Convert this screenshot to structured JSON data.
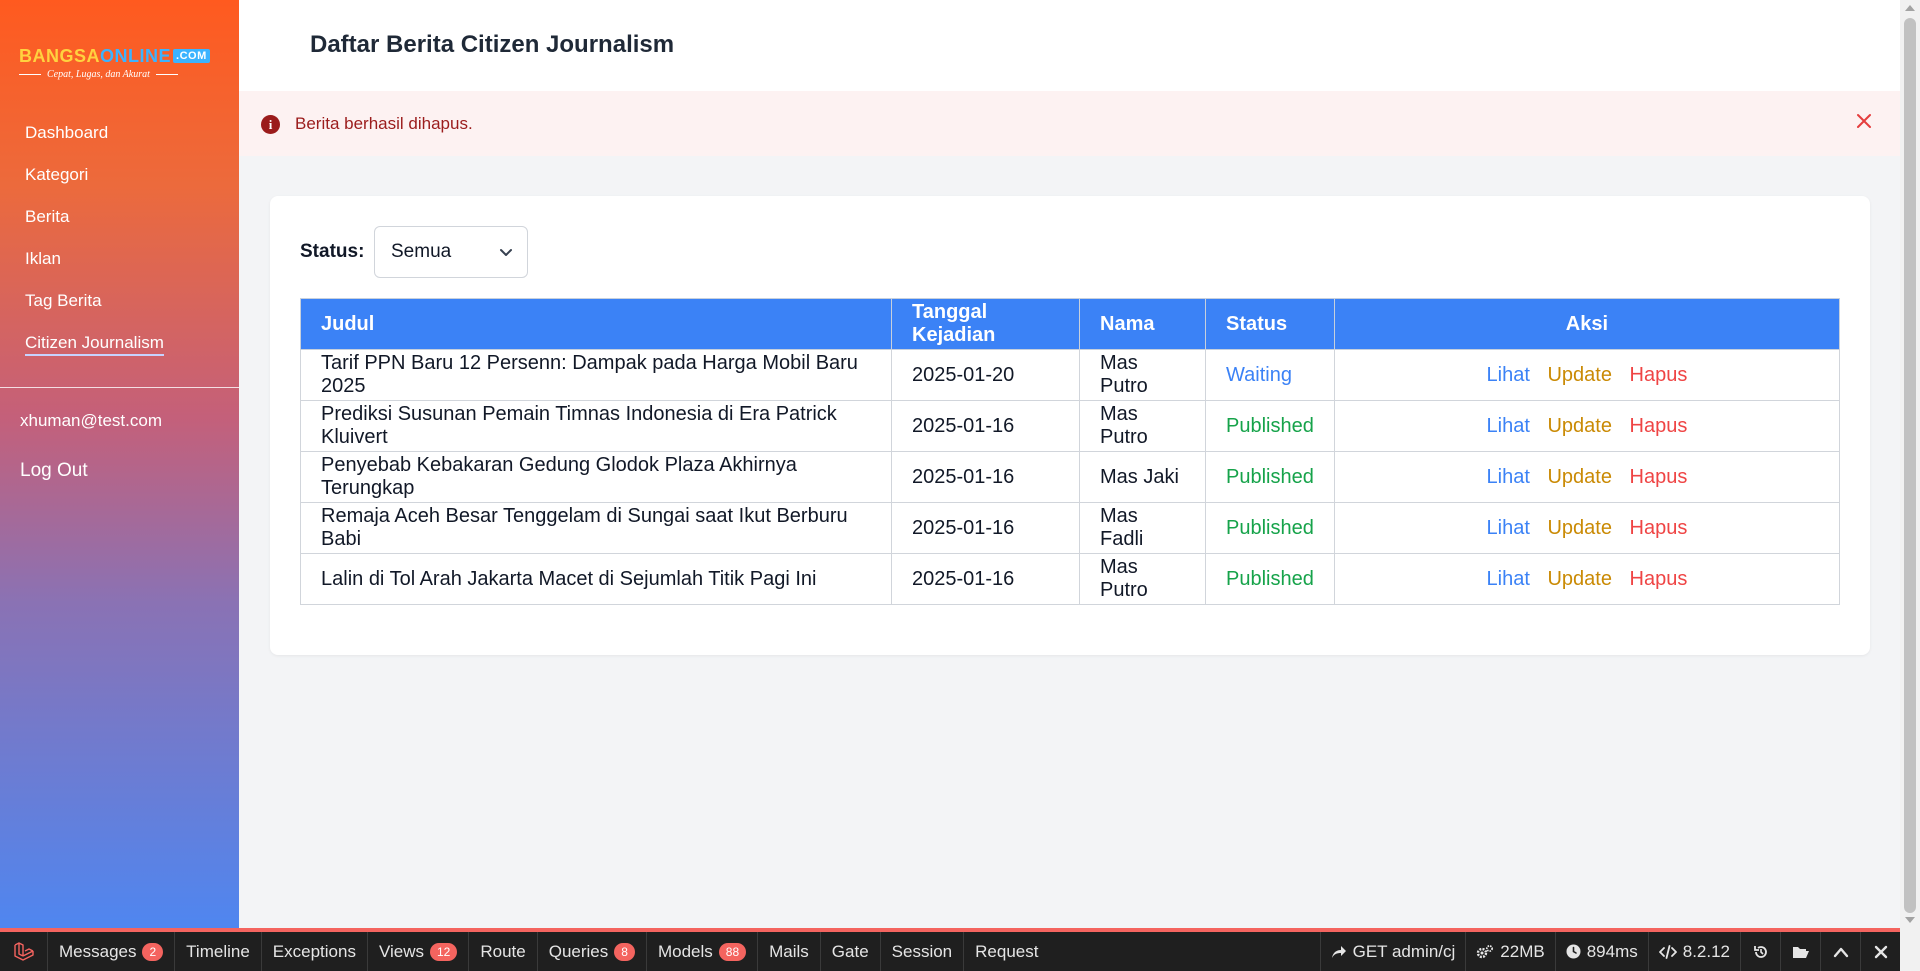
{
  "sidebar": {
    "logo": {
      "bangsa": "BANGSA",
      "online": "ONLINE",
      "com": ".COM",
      "tagline": "Cepat, Lugas, dan Akurat"
    },
    "items": [
      {
        "label": "Dashboard"
      },
      {
        "label": "Kategori"
      },
      {
        "label": "Berita"
      },
      {
        "label": "Iklan"
      },
      {
        "label": "Tag Berita"
      },
      {
        "label": "Citizen Journalism",
        "active": true
      }
    ],
    "user_email": "xhuman@test.com",
    "logout_label": "Log Out"
  },
  "header": {
    "title": "Daftar Berita Citizen Journalism"
  },
  "alert": {
    "message": "Berita berhasil dihapus.",
    "icon": "info-icon",
    "close_icon": "close-icon"
  },
  "filter": {
    "label": "Status:",
    "value": "Semua"
  },
  "table": {
    "columns": [
      "Judul",
      "Tanggal Kejadian",
      "Nama",
      "Status",
      "Aksi"
    ],
    "actions": {
      "view": "Lihat",
      "update": "Update",
      "delete": "Hapus"
    },
    "rows": [
      {
        "judul": "Tarif PPN Baru 12 Persenn: Dampak pada Harga Mobil Baru 2025",
        "tanggal": "2025-01-20",
        "nama": "Mas Putro",
        "status": "Waiting"
      },
      {
        "judul": "Prediksi Susunan Pemain Timnas Indonesia di Era Patrick Kluivert",
        "tanggal": "2025-01-16",
        "nama": "Mas Putro",
        "status": "Published"
      },
      {
        "judul": "Penyebab Kebakaran Gedung Glodok Plaza Akhirnya Terungkap",
        "tanggal": "2025-01-16",
        "nama": "Mas Jaki",
        "status": "Published"
      },
      {
        "judul": "Remaja Aceh Besar Tenggelam di Sungai saat Ikut Berburu Babi",
        "tanggal": "2025-01-16",
        "nama": "Mas Fadli",
        "status": "Published"
      },
      {
        "judul": "Lalin di Tol Arah Jakarta Macet di Sejumlah Titik Pagi Ini",
        "tanggal": "2025-01-16",
        "nama": "Mas Putro",
        "status": "Published"
      }
    ]
  },
  "debugbar": {
    "tabs": [
      {
        "label": "Messages",
        "badge": "2"
      },
      {
        "label": "Timeline"
      },
      {
        "label": "Exceptions"
      },
      {
        "label": "Views",
        "badge": "12"
      },
      {
        "label": "Route"
      },
      {
        "label": "Queries",
        "badge": "8"
      },
      {
        "label": "Models",
        "badge": "88"
      },
      {
        "label": "Mails"
      },
      {
        "label": "Gate"
      },
      {
        "label": "Session"
      },
      {
        "label": "Request"
      }
    ],
    "route": "GET admin/cj",
    "memory": "22MB",
    "time": "894ms",
    "php_version": "8.2.12"
  },
  "colors": {
    "accent": "#3b82f6",
    "alert_text": "#9b1c1c",
    "alert_bg": "#fdf2f2",
    "published": "#16a34a",
    "update": "#ca8a04",
    "delete": "#ef4444",
    "debugbar_accent": "#f4645f"
  }
}
